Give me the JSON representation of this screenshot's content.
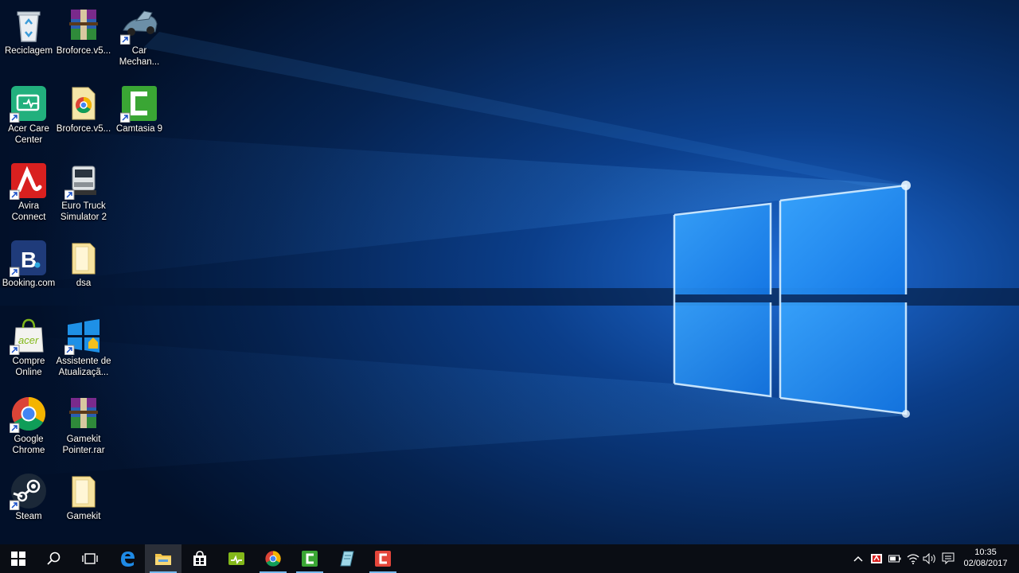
{
  "desktop": {
    "icons": [
      {
        "name": "recycle-bin",
        "label": "Reciclagem"
      },
      {
        "name": "broforce-rar",
        "label": "Broforce.v5..."
      },
      {
        "name": "car-mechanic",
        "label": "Car\nMechan..."
      },
      {
        "name": "acer-care-center",
        "label": "Acer Care\nCenter"
      },
      {
        "name": "broforce-exe",
        "label": "Broforce.v5..."
      },
      {
        "name": "camtasia-9",
        "label": "Camtasia 9"
      },
      {
        "name": "avira-connect",
        "label": "Avira\nConnect"
      },
      {
        "name": "euro-truck-simulator",
        "label": "Euro Truck\nSimulator 2"
      },
      {
        "name": "booking-com",
        "label": "Booking.com"
      },
      {
        "name": "folder-dsa",
        "label": "dsa"
      },
      {
        "name": "compre-online",
        "label": "Compre\nOnline"
      },
      {
        "name": "assistente-atualizacao",
        "label": "Assistente de\nAtualizaçã..."
      },
      {
        "name": "google-chrome",
        "label": "Google\nChrome"
      },
      {
        "name": "gamekit-pointer",
        "label": "Gamekit\nPointer.rar"
      },
      {
        "name": "steam",
        "label": "Steam"
      },
      {
        "name": "folder-gamekit",
        "label": "Gamekit"
      }
    ]
  },
  "taskbar": {
    "apps": [
      {
        "icon": "start-windows-icon"
      },
      {
        "icon": "search-icon"
      },
      {
        "icon": "task-view-icon"
      },
      {
        "icon": "edge-icon"
      },
      {
        "icon": "file-explorer-icon"
      },
      {
        "icon": "store-icon"
      },
      {
        "icon": "acer-care-icon"
      },
      {
        "icon": "chrome-icon"
      },
      {
        "icon": "camtasia-icon"
      },
      {
        "icon": "notepad-icon"
      },
      {
        "icon": "camtasia-recorder-icon"
      }
    ],
    "tray_icons": [
      "chevron-up-icon",
      "shield-icon",
      "battery-icon",
      "wifi-icon",
      "volume-icon",
      "action-center-icon"
    ],
    "time": "10:35",
    "date": "02/08/2017"
  },
  "colors": {
    "taskbar": "#0a0d14",
    "accent": "#76b9ed",
    "wallpaper_glow": "#3aa2ff"
  }
}
